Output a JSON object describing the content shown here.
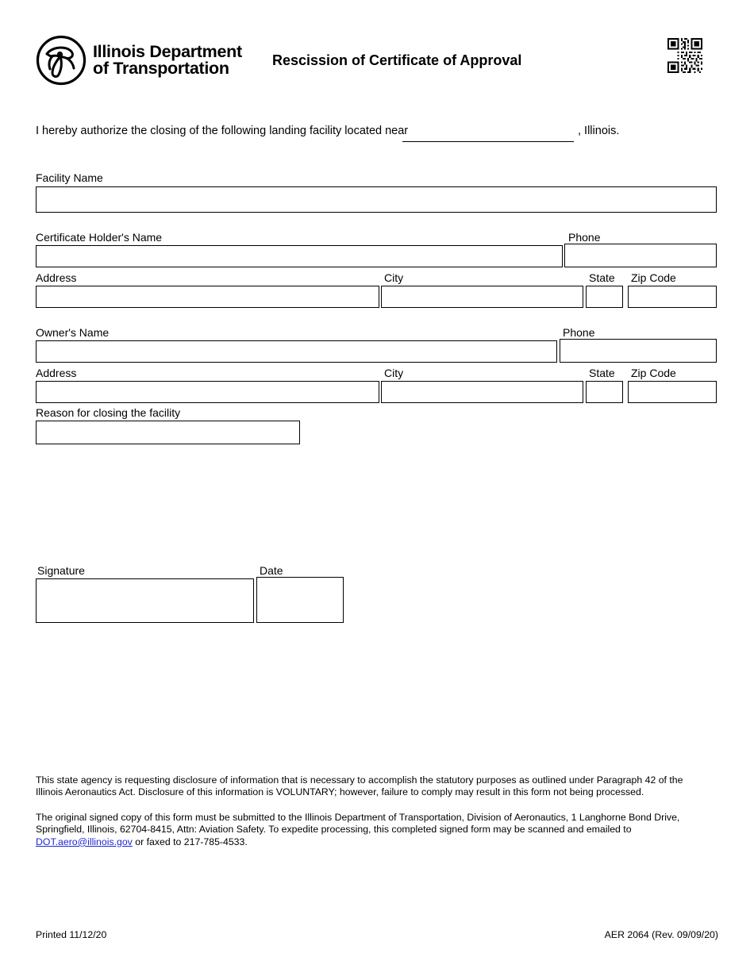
{
  "document": {
    "title": "Rescission of Certificate of Approval",
    "agency_line_1": "Illinois Department",
    "agency_line_2": "of Transportation",
    "logo_icon": "idot-circular-triskelion-logo",
    "qr_icon": "qr-code"
  },
  "intro": {
    "text": "I hereby authorize the closing of the following landing facility located near",
    "blank_value": "",
    "tail": ", Illinois."
  },
  "fields": {
    "facility_name": {
      "label": "Facility Name",
      "value": ""
    },
    "certificate_holder_name": {
      "label": "Certificate Holder's Name",
      "value": ""
    },
    "certificate_holder_phone": {
      "label": "Phone",
      "value": ""
    },
    "certificate_holder_address": {
      "label": "Address",
      "value": ""
    },
    "certificate_holder_city": {
      "label": "City",
      "value": ""
    },
    "certificate_holder_state": {
      "label": "State",
      "value": ""
    },
    "certificate_holder_zip": {
      "label": "Zip Code",
      "value": ""
    },
    "owner_name": {
      "label": "Owner's Name",
      "value": ""
    },
    "owner_phone": {
      "label": "Phone",
      "value": ""
    },
    "owner_address": {
      "label": "Address",
      "value": ""
    },
    "owner_city": {
      "label": "City",
      "value": ""
    },
    "owner_state": {
      "label": "State",
      "value": ""
    },
    "owner_zip": {
      "label": "Zip Code",
      "value": ""
    },
    "reason": {
      "label": "Reason for closing the facility",
      "value": ""
    },
    "signature": {
      "label": "Signature",
      "value": ""
    },
    "date": {
      "label": "Date",
      "value": ""
    }
  },
  "notes": {
    "disclosure": "This state agency is requesting disclosure of information that is necessary to accomplish the statutory purposes as outlined under Paragraph 42 of the Illinois Aeronautics Act.  Disclosure of this information is VOLUNTARY; however, failure to comply may result in this form not being processed.",
    "submission_part_1": "The original signed copy of this form must be submitted to the Illinois Department of Transportation, Division of Aeronautics, 1 Langhorne Bond Drive, Springfield, Illinois, 62704-8415, Attn: Aviation Safety.  To expedite processing, this completed signed form may be scanned and emailed to ",
    "submission_email": "DOT.aero@illinois.gov",
    "submission_part_2": " or faxed to 217-785-4533."
  },
  "footer": {
    "printed": "Printed 11/12/20",
    "form_number": "AER 2064 (Rev. 09/09/20)"
  },
  "colors": {
    "link": "#2027d4",
    "text": "#000000",
    "border": "#000000",
    "page_background": "#ffffff"
  }
}
